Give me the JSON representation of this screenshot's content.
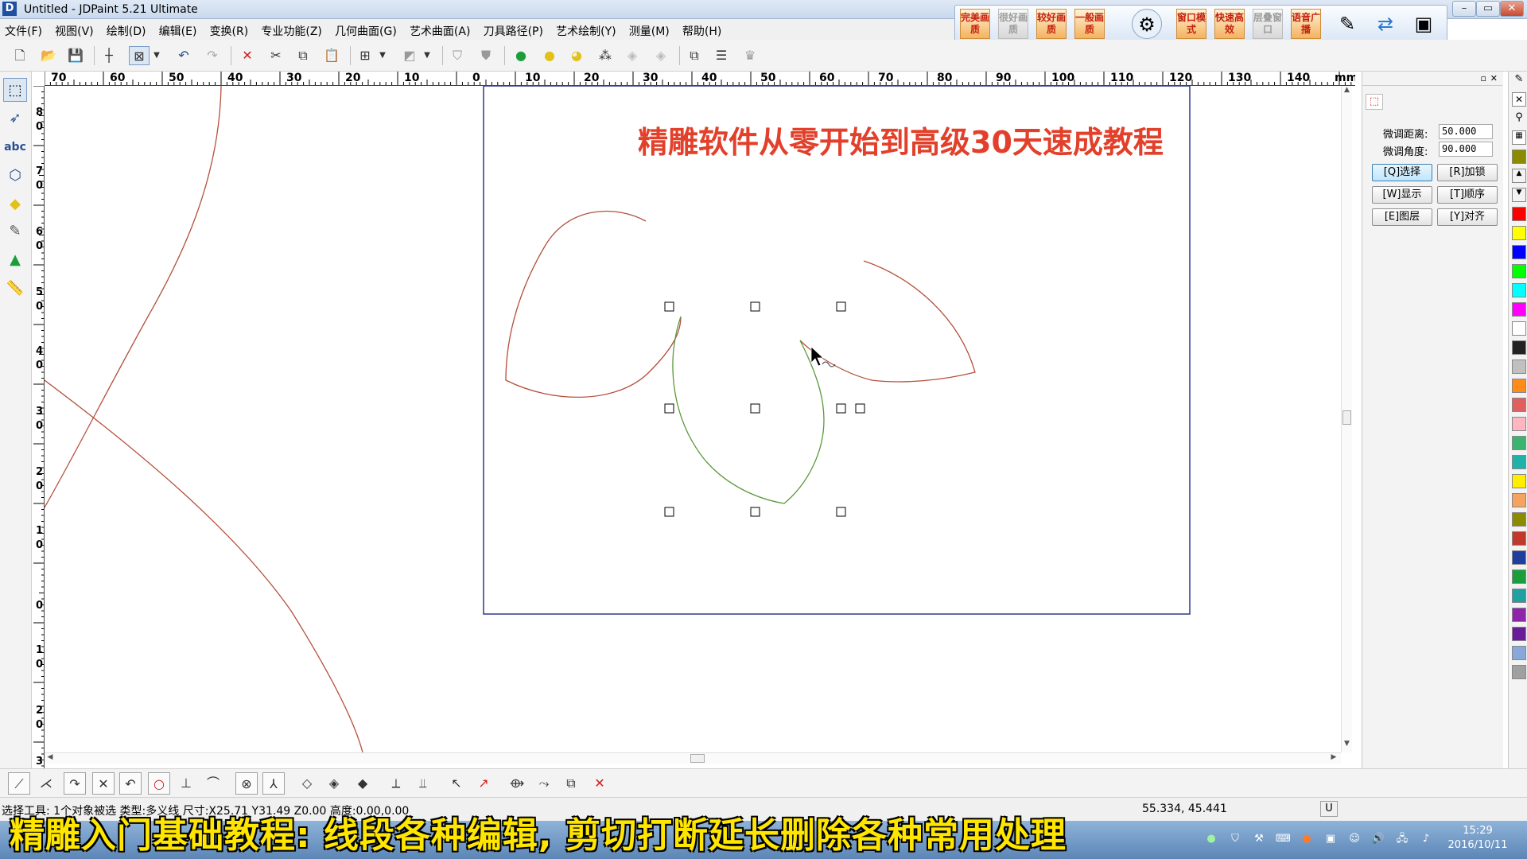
{
  "window": {
    "title": "Untitled - JDPaint 5.21 Ultimate",
    "icon_letter": "D"
  },
  "menu": [
    "文件(F)",
    "视图(V)",
    "绘制(D)",
    "编辑(E)",
    "变换(R)",
    "专业功能(Z)",
    "几何曲面(G)",
    "艺术曲面(A)",
    "刀具路径(P)",
    "艺术绘制(Y)",
    "测量(M)",
    "帮助(H)"
  ],
  "quality": [
    "完美画质",
    "很好画质",
    "较好画质",
    "一般画质",
    "窗口模式",
    "快速高效",
    "层叠窗口",
    "语音广播"
  ],
  "ruler": {
    "unit": "mm",
    "h_labels": [
      "70",
      "60",
      "50",
      "40",
      "30",
      "20",
      "10",
      "0",
      "10",
      "20",
      "30",
      "40",
      "50",
      "60",
      "70",
      "80",
      "90",
      "100",
      "110",
      "120",
      "130",
      "140"
    ],
    "v_labels": [
      "8",
      "0",
      "7",
      "0",
      "6",
      "0",
      "5",
      "0",
      "4",
      "0",
      "3",
      "0",
      "2",
      "0",
      "1",
      "0",
      "0",
      "1",
      "0",
      "2",
      "0",
      "3"
    ]
  },
  "canvas": {
    "watermark": "精雕软件从零开始到高级30天速成教程",
    "colors": {
      "curve": "#b5503c",
      "selected_curve": "#5a9a3a",
      "frame": "#2b3a8a"
    }
  },
  "panel": {
    "dist_label": "微调距离:",
    "dist_value": "50.000",
    "angle_label": "微调角度:",
    "angle_value": "90.000",
    "buttons": [
      "[Q]选择",
      "[R]加锁",
      "[W]显示",
      "[T]顺序",
      "[E]图层",
      "[Y]对齐"
    ]
  },
  "palette": [
    "#ff0000",
    "#ffff00",
    "#0000ff",
    "#00ff00",
    "#00ffff",
    "#ff00ff",
    "#ffffff",
    "#222222",
    "#c0c0c0",
    "#ff8c1a",
    "#e06060",
    "#ffb6c1",
    "#3cb371",
    "#20b2aa",
    "#ffee00",
    "#f4a460",
    "#8b8b00",
    "#c0392b",
    "#1e3fa0",
    "#1a9e3a",
    "#20a0a0",
    "#8e24aa",
    "#6a1b9a",
    "#87a8d8",
    "#a0a0a0"
  ],
  "status": {
    "text": "选择工具: 1个对象被选 类型:多义线 尺寸:X25.71 Y31.49 Z0.00 高度:0.00,0.00",
    "coords": "55.334, 45.441",
    "mode": "U"
  },
  "taskbar": {
    "time": "15:29",
    "date": "2016/10/11"
  },
  "subtitle": "精雕入门基础教程: 线段各种编辑, 剪切打断延长删除各种常用处理"
}
